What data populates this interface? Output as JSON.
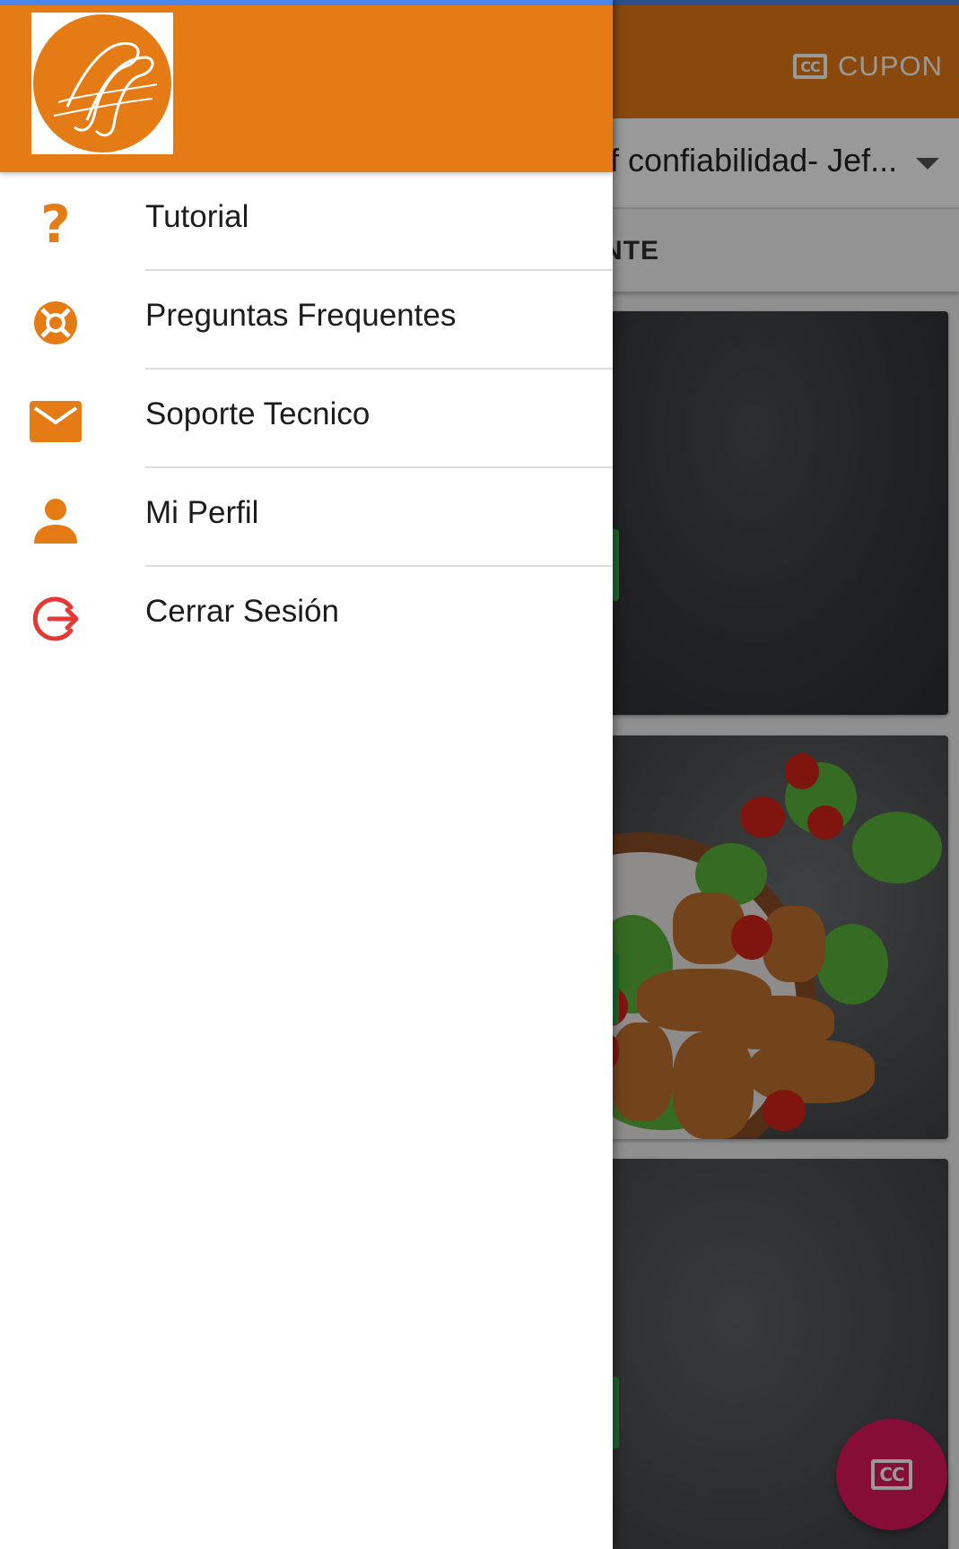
{
  "background_app": {
    "toolbar": {
      "cupon_label": "CUPON",
      "cupon_icon": "cc-coupon-icon"
    },
    "store_select": {
      "value": "f confiabilidad- Jef..."
    },
    "tab_label": "NTE",
    "fab_icon": "cc-coupon-icon"
  },
  "drawer": {
    "logo_icon": "ff-logo-icon",
    "items": [
      {
        "label": "Tutorial",
        "icon": "help-icon"
      },
      {
        "label": "Preguntas Frequentes",
        "icon": "lifebuoy-icon"
      },
      {
        "label": "Soporte Tecnico",
        "icon": "mail-icon"
      },
      {
        "label": "Mi Perfil",
        "icon": "person-icon"
      },
      {
        "label": "Cerrar Sesión",
        "icon": "logout-icon"
      }
    ]
  },
  "colors": {
    "primary": "#e57b15",
    "logout": "#e53935",
    "fab": "#e0165a",
    "status_bar": "#4a86e8"
  }
}
